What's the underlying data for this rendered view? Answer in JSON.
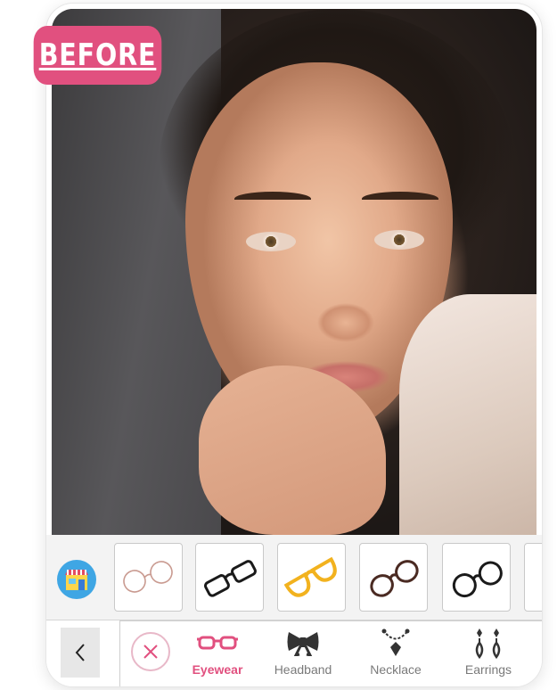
{
  "badge": {
    "label": "BEFORE"
  },
  "tray": {
    "items": [
      {
        "name": "rimless-oval-glasses",
        "color": "#c99a90"
      },
      {
        "name": "black-rectangle-glasses",
        "color": "#1a1a1a"
      },
      {
        "name": "yellow-cat-eye-glasses",
        "color": "#f2b21e"
      },
      {
        "name": "brown-round-glasses",
        "color": "#4a2a22"
      },
      {
        "name": "black-round-glasses",
        "color": "#1a1a1a"
      }
    ]
  },
  "categories": [
    {
      "label": "Eyewear",
      "icon": "eyewear-icon",
      "active": true
    },
    {
      "label": "Headband",
      "icon": "bow-icon",
      "active": false
    },
    {
      "label": "Necklace",
      "icon": "necklace-icon",
      "active": false
    },
    {
      "label": "Earrings",
      "icon": "earrings-icon",
      "active": false
    }
  ],
  "colors": {
    "accent": "#e1507f",
    "store": "#3fa6e4"
  }
}
